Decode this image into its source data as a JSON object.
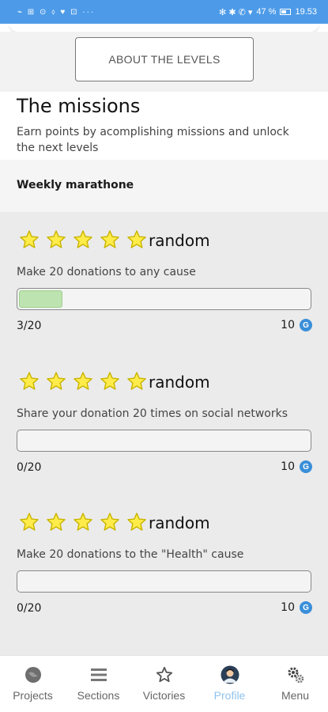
{
  "status_bar": {
    "left_icons": "⌁ ⊞ ⊙ ⬨ ♥ ⊡ ···",
    "right_icons": "✻ ✱ ✆ ▾",
    "battery": "47 %",
    "time": "19.53"
  },
  "levels": {
    "button_label": "ABOUT THE LEVELS"
  },
  "missions": {
    "title": "The missions",
    "subtitle": "Earn points by acomplishing missions and unlock the next levels"
  },
  "weekly": {
    "label": "Weekly marathone"
  },
  "mission_items": [
    {
      "tag": "random",
      "description": "Make 20 donations to any cause",
      "count": "3/20",
      "progress": 0.15,
      "points": "10",
      "coin_symbol": "G"
    },
    {
      "tag": "random",
      "description": "Share your donation 20 times on social networks",
      "count": "0/20",
      "progress": 0,
      "points": "10",
      "coin_symbol": "G"
    },
    {
      "tag": "random",
      "description": "Make 20 donations to the \"Health\" cause",
      "count": "0/20",
      "progress": 0,
      "points": "10",
      "coin_symbol": "G"
    }
  ],
  "nav": {
    "items": [
      {
        "label": "Projects",
        "icon": "globe-icon"
      },
      {
        "label": "Sections",
        "icon": "menu-lines-icon"
      },
      {
        "label": "Victories",
        "icon": "star-icon"
      },
      {
        "label": "Profile",
        "icon": "avatar-icon",
        "active": true
      },
      {
        "label": "Menu",
        "icon": "gears-icon"
      }
    ]
  },
  "colors": {
    "status_bar": "#4d9be8",
    "star_fill": "#ffec4a",
    "star_stroke": "#c9b400",
    "progress_fill": "#bde3b0",
    "coin": "#3a8fd9",
    "nav_active": "#8fc3ee"
  }
}
